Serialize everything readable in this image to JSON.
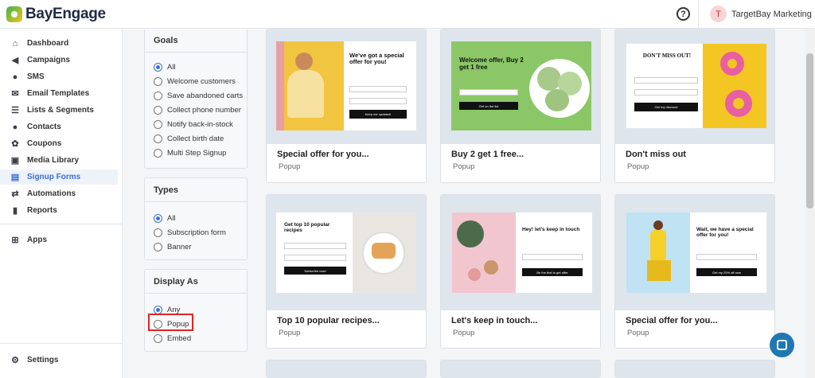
{
  "app": {
    "brand": "BayEngage",
    "user_initial": "T",
    "user_name": "TargetBay Marketing"
  },
  "sidebar": {
    "items": [
      {
        "label": "Dashboard",
        "icon": "home-icon"
      },
      {
        "label": "Campaigns",
        "icon": "megaphone-icon"
      },
      {
        "label": "SMS",
        "icon": "chat-bubble-icon"
      },
      {
        "label": "Email Templates",
        "icon": "envelope-icon"
      },
      {
        "label": "Lists & Segments",
        "icon": "list-icon"
      },
      {
        "label": "Contacts",
        "icon": "person-icon"
      },
      {
        "label": "Coupons",
        "icon": "coupon-icon"
      },
      {
        "label": "Media Library",
        "icon": "image-add-icon"
      },
      {
        "label": "Signup Forms",
        "icon": "form-icon"
      },
      {
        "label": "Automations",
        "icon": "automation-icon"
      },
      {
        "label": "Reports",
        "icon": "bar-chart-icon"
      }
    ],
    "apps_label": "Apps",
    "settings_label": "Settings",
    "active": "Signup Forms"
  },
  "filters": {
    "goals": {
      "title": "Goals",
      "options": [
        "All",
        "Welcome customers",
        "Save abandoned carts",
        "Collect phone number",
        "Notify back-in-stock",
        "Collect birth date",
        "Multi Step Signup"
      ],
      "selected": "All"
    },
    "types": {
      "title": "Types",
      "options": [
        "All",
        "Subscription form",
        "Banner"
      ],
      "selected": "All"
    },
    "display": {
      "title": "Display As",
      "options": [
        "Any",
        "Popup",
        "Embed"
      ],
      "selected": "Any"
    }
  },
  "templates": [
    {
      "title": "Special offer for you...",
      "type": "Popup",
      "headline": "We've got a special offer for you!",
      "cta": "Keep me updated!"
    },
    {
      "title": "Buy 2 get 1 free...",
      "type": "Popup",
      "headline": "Welcome offer, Buy 2 get 1 free",
      "cta": "Get on the list"
    },
    {
      "title": "Don't miss out",
      "type": "Popup",
      "headline": "DON'T MISS OUT!",
      "cta": "Get my discount"
    },
    {
      "title": "Top 10 popular recipes...",
      "type": "Popup",
      "headline": "Get top 10 popular recipes",
      "cta": "Subscribe now!"
    },
    {
      "title": "Let's keep in touch...",
      "type": "Popup",
      "headline": "Hey! let's keep in touch",
      "cta": "Be the first to get offer"
    },
    {
      "title": "Special offer for you...",
      "type": "Popup",
      "headline": "Wait, we have a special offer for you!",
      "cta": "Get my 20% off now"
    }
  ],
  "colors": {
    "accent": "#3b6fd8",
    "highlight": "#e02424",
    "chat": "#1f77b4"
  }
}
